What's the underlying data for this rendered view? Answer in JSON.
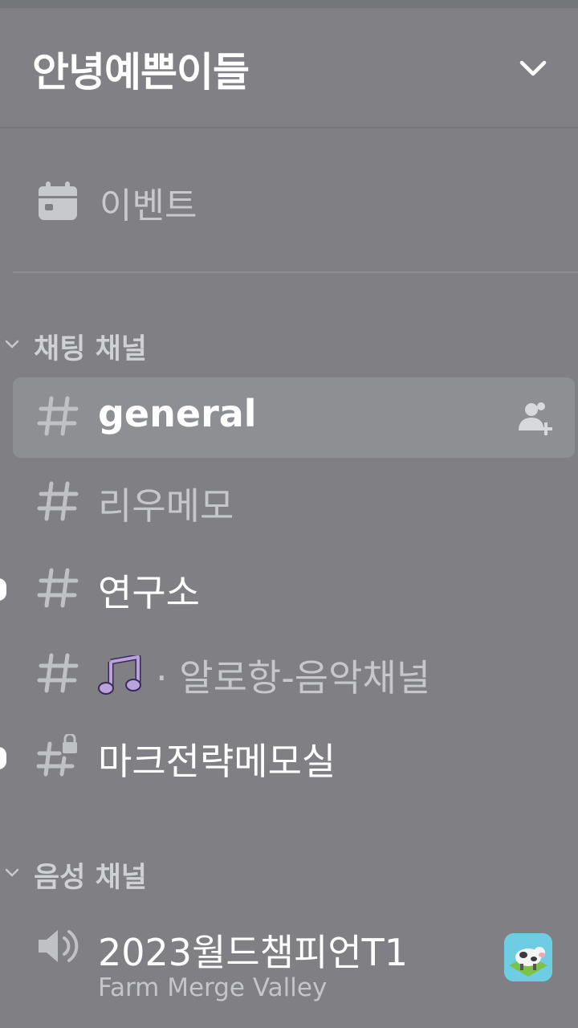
{
  "server": {
    "name": "안녕예쁜이들"
  },
  "events": {
    "label": "이벤트",
    "icon": "calendar-icon"
  },
  "categories": [
    {
      "label": "채팅 채널"
    },
    {
      "label": "음성 채널"
    }
  ],
  "text_channels": [
    {
      "name": "general",
      "icon": "hash-icon",
      "selected": true
    },
    {
      "name": "리우메모",
      "icon": "hash-icon"
    },
    {
      "name": "연구소",
      "icon": "hash-icon",
      "unread": true
    },
    {
      "name": "· 알로항-음악채널",
      "icon": "hash-icon",
      "emoji": "musical-note-icon"
    },
    {
      "name": "마크전략메모실",
      "icon": "locked-hash-icon",
      "unread": true
    }
  ],
  "voice_channels": [
    {
      "name": "2023월드챔피언T1",
      "icon": "speaker-icon",
      "activity": "Farm Merge Valley"
    }
  ],
  "colors": {
    "background": "#808084",
    "selected_channel": "#8e8f93",
    "text_muted": "#c6c7ca",
    "text_active": "#ffffff"
  }
}
